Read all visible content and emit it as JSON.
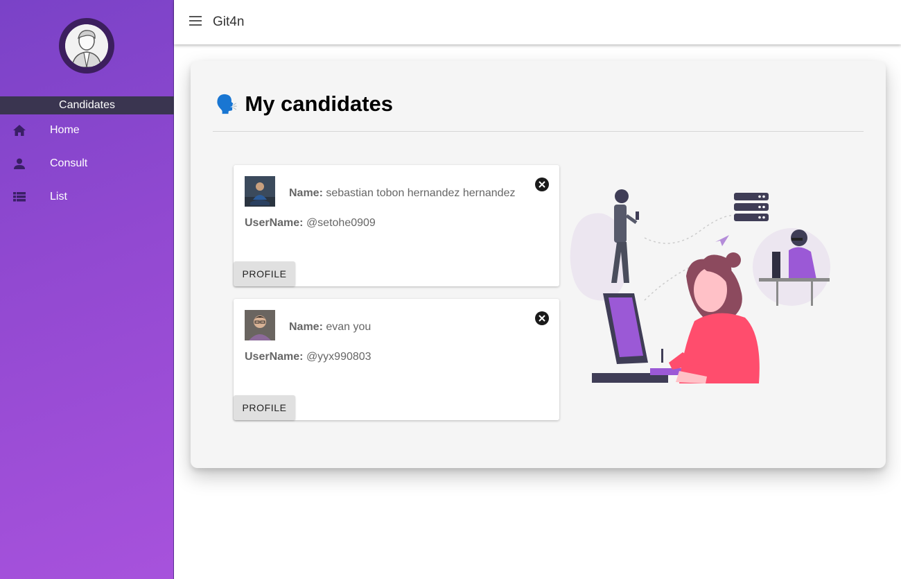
{
  "app": {
    "title": "Git4n"
  },
  "sidebar": {
    "section_title": "Candidates",
    "items": [
      {
        "label": "Home",
        "icon": "home-icon"
      },
      {
        "label": "Consult",
        "icon": "person-icon"
      },
      {
        "label": "List",
        "icon": "list-icon"
      }
    ]
  },
  "page": {
    "title_emoji": "🗣️",
    "title": "My candidates"
  },
  "candidates": [
    {
      "name_label": "Name:",
      "name": "sebastian tobon hernandez hernandez",
      "username_label": "UserName:",
      "username": "@setohe0909",
      "button_label": "PROFILE"
    },
    {
      "name_label": "Name:",
      "name": "evan you",
      "username_label": "UserName:",
      "username": "@yyx990803",
      "button_label": "PROFILE"
    }
  ],
  "colors": {
    "sidebar_start": "#7a42c7",
    "sidebar_end": "#a752dc",
    "section_bar": "#3a3550",
    "accent": "#ff4d6d"
  }
}
